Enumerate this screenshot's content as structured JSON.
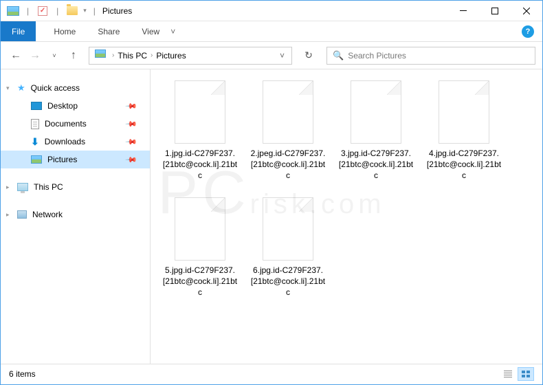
{
  "titlebar": {
    "title": "Pictures"
  },
  "ribbon": {
    "file": "File",
    "tabs": [
      "Home",
      "Share",
      "View"
    ]
  },
  "breadcrumb": {
    "items": [
      "This PC",
      "Pictures"
    ]
  },
  "search": {
    "placeholder": "Search Pictures"
  },
  "sidebar": {
    "quickaccess": "Quick access",
    "items": [
      {
        "label": "Desktop",
        "icon": "desktop",
        "pinned": true
      },
      {
        "label": "Documents",
        "icon": "documents",
        "pinned": true
      },
      {
        "label": "Downloads",
        "icon": "downloads",
        "pinned": true
      },
      {
        "label": "Pictures",
        "icon": "pictures",
        "pinned": true,
        "selected": true
      }
    ],
    "thispc": "This PC",
    "network": "Network"
  },
  "files": [
    {
      "name": "1.jpg.id-C279F237.[21btc@cock.li].21btc"
    },
    {
      "name": "2.jpeg.id-C279F237.[21btc@cock.li].21btc"
    },
    {
      "name": "3.jpg.id-C279F237.[21btc@cock.li].21btc"
    },
    {
      "name": "4.jpg.id-C279F237.[21btc@cock.li].21btc"
    },
    {
      "name": "5.jpg.id-C279F237.[21btc@cock.li].21btc"
    },
    {
      "name": "6.jpg.id-C279F237.[21btc@cock.li].21btc"
    }
  ],
  "status": {
    "count": "6 items"
  }
}
